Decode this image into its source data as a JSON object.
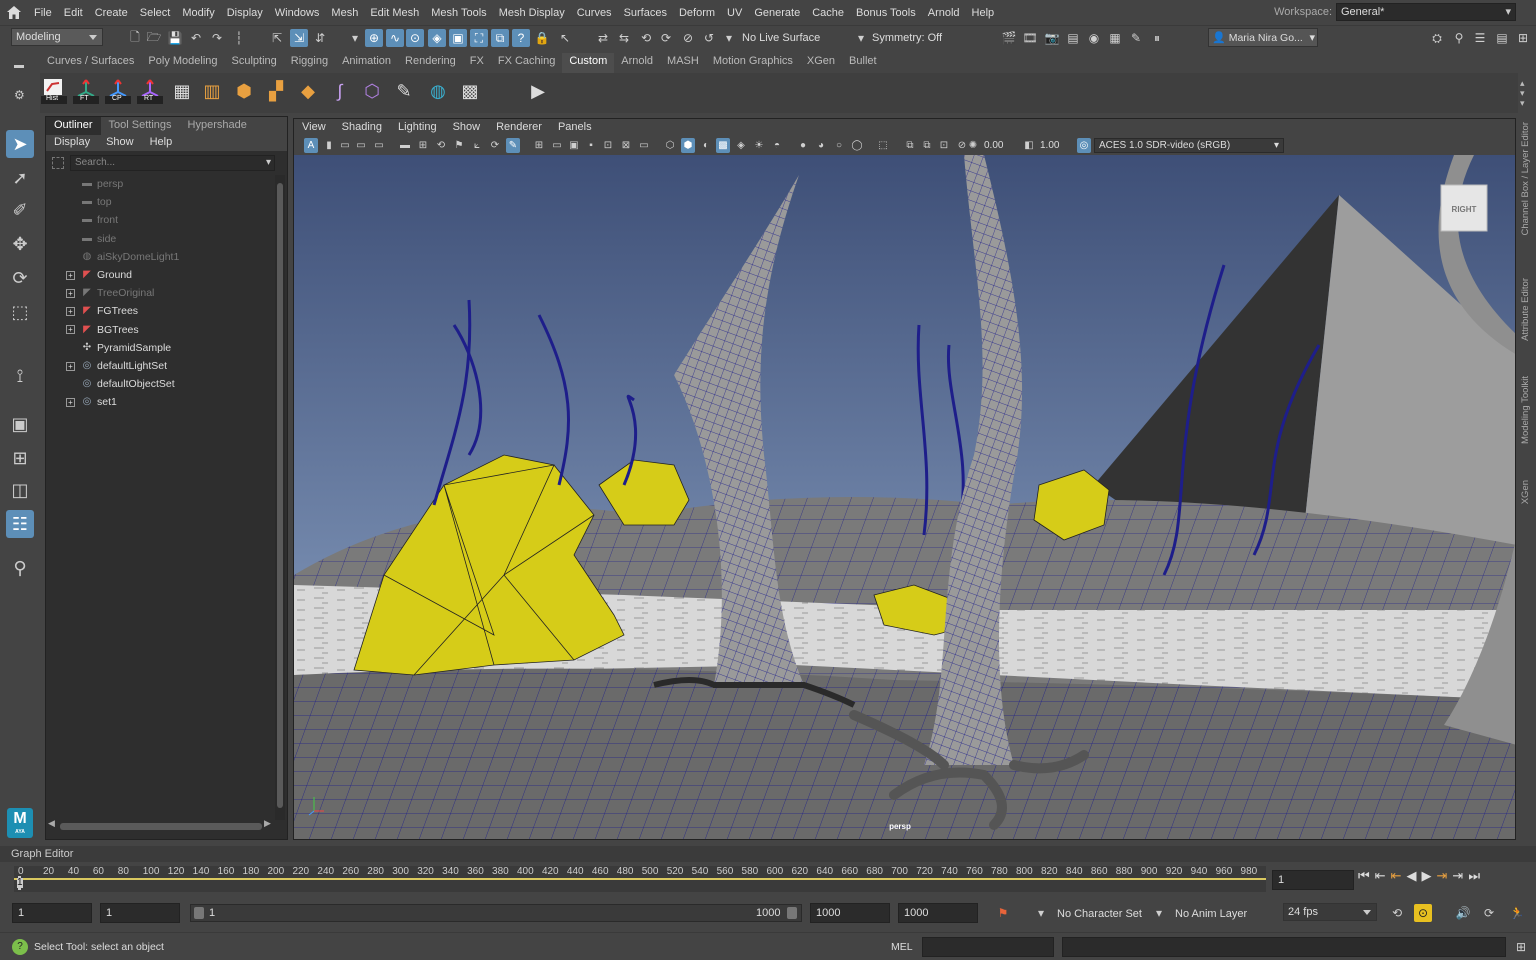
{
  "menubar": {
    "items": [
      "File",
      "Edit",
      "Create",
      "Select",
      "Modify",
      "Display",
      "Windows",
      "Mesh",
      "Edit Mesh",
      "Mesh Tools",
      "Mesh Display",
      "Curves",
      "Surfaces",
      "Deform",
      "UV",
      "Generate",
      "Cache",
      "Bonus Tools",
      "Arnold",
      "Help"
    ],
    "workspace_label": "Workspace:",
    "workspace_value": "General*"
  },
  "statusline": {
    "menuset": "Modeling",
    "live_surface": "No Live Surface",
    "symmetry": "Symmetry: Off",
    "user": "Maria Nira Go..."
  },
  "shelf": {
    "tabs": [
      "Curves / Surfaces",
      "Poly Modeling",
      "Sculpting",
      "Rigging",
      "Animation",
      "Rendering",
      "FX",
      "FX Caching",
      "Custom",
      "Arnold",
      "MASH",
      "Motion Graphics",
      "XGen",
      "Bullet"
    ],
    "active_tab": "Custom",
    "button_labels": [
      "Hist",
      "FT",
      "CP",
      "RT"
    ]
  },
  "outliner": {
    "tabs": [
      "Outliner",
      "Tool Settings",
      "Hypershade"
    ],
    "menu": [
      "Display",
      "Show",
      "Help"
    ],
    "search_placeholder": "Search...",
    "items": [
      {
        "label": "persp",
        "icon": "camera-icon",
        "dim": true,
        "expand": false
      },
      {
        "label": "top",
        "icon": "camera-icon",
        "dim": true,
        "expand": false
      },
      {
        "label": "front",
        "icon": "camera-icon",
        "dim": true,
        "expand": false
      },
      {
        "label": "side",
        "icon": "camera-icon",
        "dim": true,
        "expand": false
      },
      {
        "label": "aiSkyDomeLight1",
        "icon": "skydome-light-icon",
        "dim": true,
        "expand": false
      },
      {
        "label": "Ground",
        "icon": "mesh-transform-icon",
        "dim": false,
        "expand": true
      },
      {
        "label": "TreeOriginal",
        "icon": "mesh-transform-icon",
        "dim": true,
        "expand": true
      },
      {
        "label": "FGTrees",
        "icon": "mesh-transform-icon",
        "dim": false,
        "expand": true
      },
      {
        "label": "BGTrees",
        "icon": "mesh-transform-icon",
        "dim": false,
        "expand": true
      },
      {
        "label": "PyramidSample",
        "icon": "pyramid-icon",
        "dim": false,
        "expand": false
      },
      {
        "label": "defaultLightSet",
        "icon": "set-icon",
        "dim": false,
        "expand": true
      },
      {
        "label": "defaultObjectSet",
        "icon": "set-icon",
        "dim": false,
        "expand": false
      },
      {
        "label": "set1",
        "icon": "set-icon",
        "dim": false,
        "expand": true
      }
    ]
  },
  "viewport": {
    "menu": [
      "View",
      "Shading",
      "Lighting",
      "Show",
      "Renderer",
      "Panels"
    ],
    "exposure": "0.00",
    "gamma": "1.00",
    "color_space": "ACES 1.0 SDR-video (sRGB)",
    "camera_label": "persp",
    "view_cube_label": "RIGHT"
  },
  "right_tabs": [
    "Channel Box / Layer Editor",
    "Attribute Editor",
    "Modeling Toolkit",
    "XGen"
  ],
  "timeline": {
    "graph_editor_label": "Graph Editor",
    "ticks": [
      "0",
      "20",
      "40",
      "60",
      "80",
      "100",
      "120",
      "140",
      "160",
      "180",
      "200",
      "220",
      "240",
      "260",
      "280",
      "300",
      "320",
      "340",
      "360",
      "380",
      "400",
      "420",
      "440",
      "460",
      "480",
      "500",
      "520",
      "540",
      "560",
      "580",
      "600",
      "620",
      "640",
      "660",
      "680",
      "700",
      "720",
      "740",
      "760",
      "780",
      "800",
      "820",
      "840",
      "860",
      "880",
      "900",
      "920",
      "940",
      "960",
      "980"
    ],
    "current_frame_marker": "1",
    "current_frame": "1"
  },
  "range": {
    "start": "1",
    "anim_start": "1",
    "slider_start": "1",
    "slider_end": "1000",
    "anim_end": "1000",
    "end": "1000",
    "character_set": "No Character Set",
    "anim_layer": "No Anim Layer",
    "fps": "24 fps"
  },
  "helpline": {
    "message": "Select Tool: select an object",
    "mel_label": "MEL"
  },
  "colors": {
    "accent": "#5d8fb8",
    "wire": "#1a1a7a",
    "selected_yellow": "#d6cc18",
    "sky_top": "#3e4f77",
    "sky_bottom": "#8fa5c6"
  }
}
